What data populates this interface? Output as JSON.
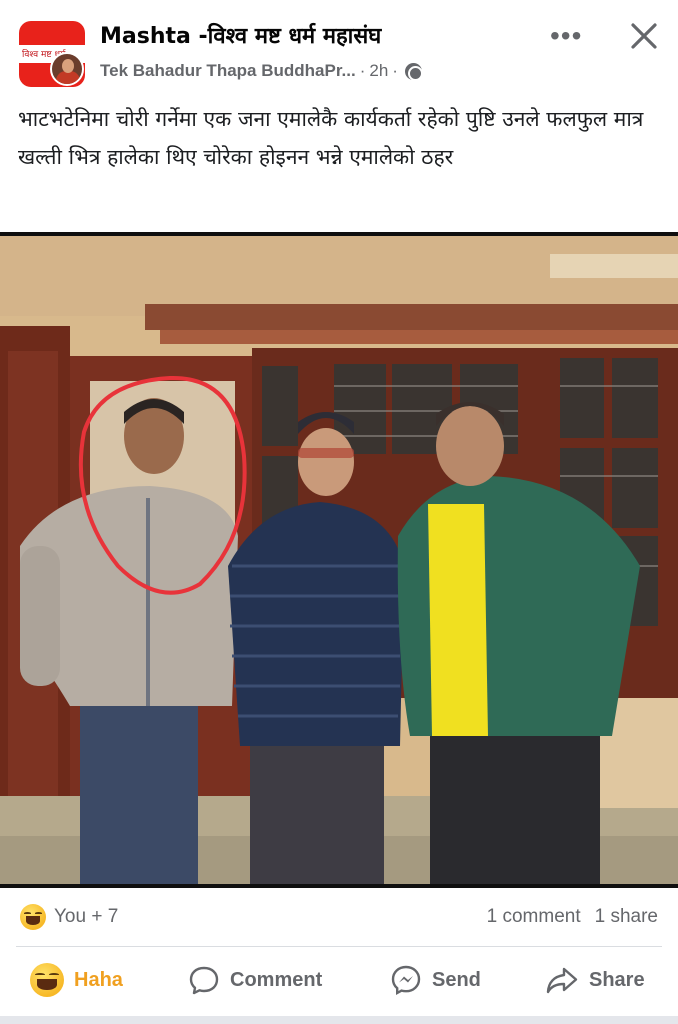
{
  "post": {
    "group_name": "Mashta -विश्व मष्ट धर्म महासंघ",
    "author": "Tek Bahadur Thapa BuddhaPr...",
    "separator": "·",
    "time": "2h",
    "more_label": "•••",
    "group_avatar_text": "विश्व मष्ट धर्म",
    "caption": "भाटभटेनिमा चोरी गर्नेमा एक जना एमालेकै कार्यकर्ता रहेको पुष्टि उनले फलफुल मात्र खल्ती भित्र हालेका थिए चोरेका होइनन भन्ने एमालेको ठहर"
  },
  "reactions": {
    "count": "You + 7",
    "comments": "1 comment",
    "shares": "1 share"
  },
  "actions": {
    "haha": "Haha",
    "comment": "Comment",
    "send": "Send",
    "share": "Share"
  },
  "icons": {
    "more": "more-options-icon",
    "close": "close-icon",
    "privacy": "globe-icon",
    "reaction": "haha-emoji-icon",
    "comment": "comment-bubble-icon",
    "send": "messenger-icon",
    "share": "share-arrow-icon"
  },
  "colors": {
    "haha_active": "#f0a020",
    "muted_text": "#65676b",
    "highlight_circle": "#e8333a",
    "group_avatar_red": "#e8221b"
  }
}
